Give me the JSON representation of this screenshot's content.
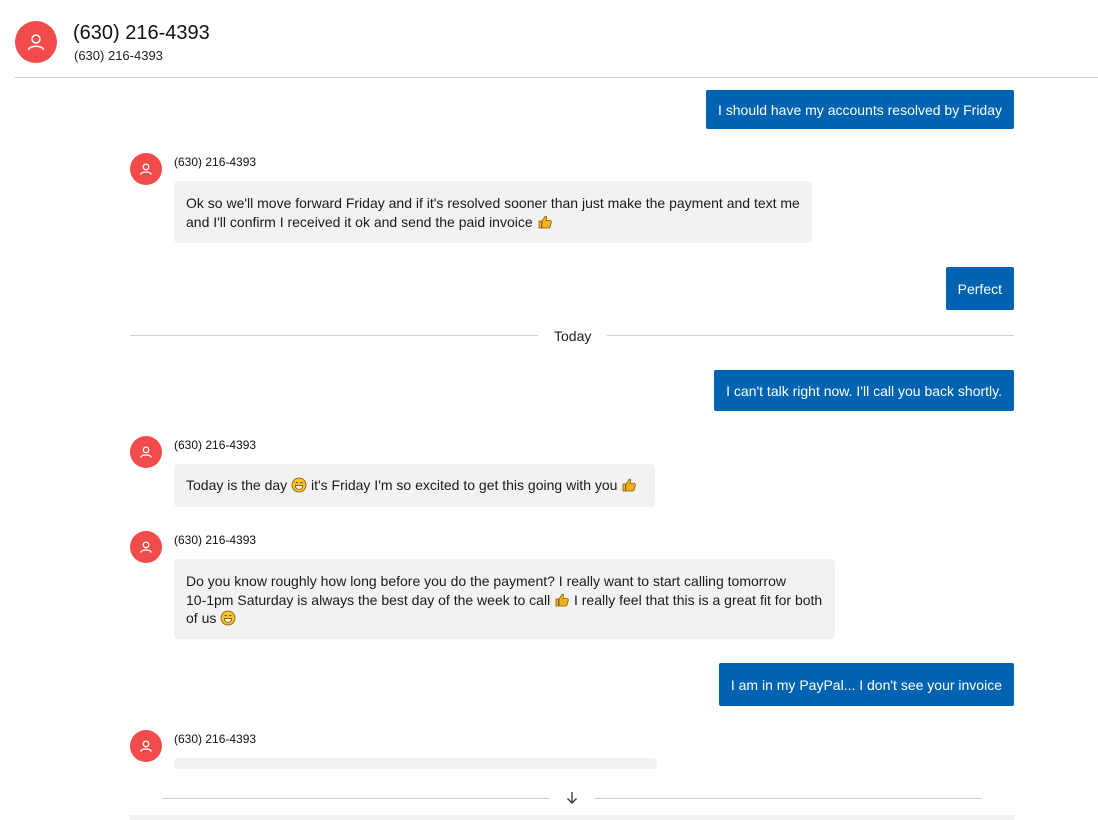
{
  "header": {
    "title": "(630) 216-4393",
    "subtitle": "(630) 216-4393"
  },
  "day_separator": {
    "label": "Today"
  },
  "messages": [
    {
      "direction": "out",
      "text": "I should have my accounts resolved by Friday"
    },
    {
      "direction": "in",
      "sender": "(630) 216-4393",
      "lines": [
        "Ok so we'll move forward Friday and if it's resolved sooner than just make the payment and text me",
        "and I'll confirm I received it ok and send the paid invoice"
      ],
      "trailing_emoji": "thumbs-up"
    },
    {
      "direction": "out",
      "text": "Perfect"
    },
    {
      "direction": "out",
      "text": "I can't talk right now. I'll call you back shortly."
    },
    {
      "direction": "in",
      "sender": "(630) 216-4393",
      "parts": [
        "Today is the day",
        "it's Friday I'm so excited to get this going with you"
      ],
      "emojis": [
        "grin",
        "thumbs-up"
      ]
    },
    {
      "direction": "in",
      "sender": "(630) 216-4393",
      "lines": [
        "Do you know roughly how long before you do the payment? I really want to start calling tomorrow",
        "10-1pm Saturday is always the best day of the week to call",
        "I really feel that this is a great fit for both",
        "of us"
      ],
      "emojis": [
        "thumbs-up",
        "grin"
      ]
    },
    {
      "direction": "out",
      "text": "I am in my PayPal... I don't see your invoice"
    },
    {
      "direction": "in",
      "sender": "(630) 216-4393",
      "text": ""
    }
  ],
  "icons": {
    "avatar": "person-icon",
    "scroll": "arrow-down-icon",
    "thumbs_up": "thumbs-up-emoji",
    "grin": "grinning-emoji"
  },
  "colors": {
    "avatar_bg": "#f14b4b",
    "outgoing_bubble": "#0063b1",
    "incoming_bubble": "#f2f2f2"
  }
}
